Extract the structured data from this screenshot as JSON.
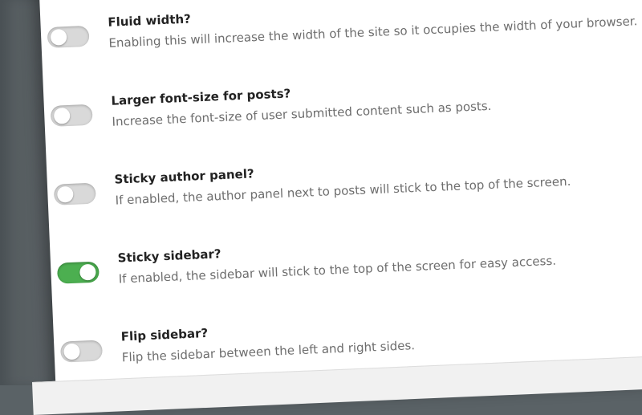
{
  "colors": {
    "toggle_on": "#4caf50",
    "toggle_off": "#d9d9d9",
    "title_text": "#222222",
    "desc_text": "#6d6d6d"
  },
  "settings": [
    {
      "title": "Fluid width?",
      "description": "Enabling this will increase the width of the site so it occupies the width of your browser. Usefu",
      "enabled": false
    },
    {
      "title": "Larger font-size for posts?",
      "description": "Increase the font-size of user submitted content such as posts.",
      "enabled": false
    },
    {
      "title": "Sticky author panel?",
      "description": "If enabled, the author panel next to posts will stick to the top of the screen.",
      "enabled": false
    },
    {
      "title": "Sticky sidebar?",
      "description": "If enabled, the sidebar will stick to the top of the screen for easy access.",
      "enabled": true
    },
    {
      "title": "Flip sidebar?",
      "description": "Flip the sidebar between the left and right sides.",
      "enabled": false
    }
  ]
}
